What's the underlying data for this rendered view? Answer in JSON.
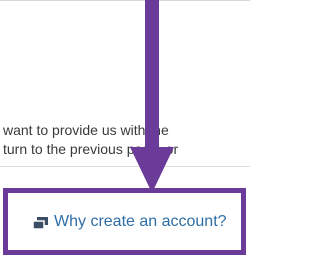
{
  "body_text": {
    "line_1": "want to provide us with the",
    "line_2": "turn to the previous page, or"
  },
  "account_link": {
    "label": "Why create an account?",
    "icon": "window-stack-icon"
  },
  "colors": {
    "annotation": "#6b3b9a",
    "link": "#2e6ea6",
    "text": "#3a3a3a"
  }
}
